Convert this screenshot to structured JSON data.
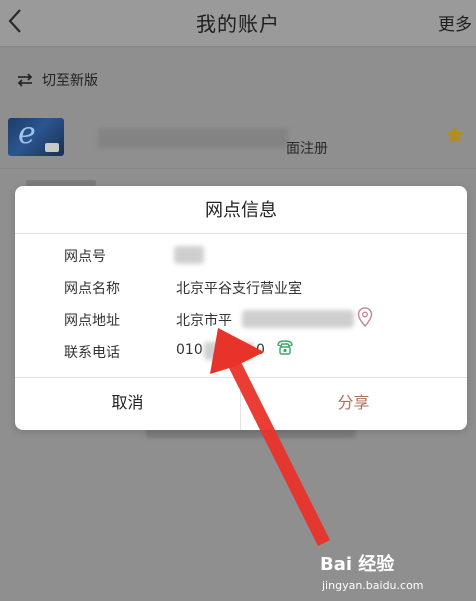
{
  "header": {
    "title": "我的账户",
    "more_label": "更多"
  },
  "switch_version": {
    "label": "切至新版"
  },
  "account": {
    "status_text": "面注册"
  },
  "dialog": {
    "title": "网点信息",
    "rows": [
      {
        "label": "网点号",
        "value": ""
      },
      {
        "label": "网点名称",
        "value": "北京平谷支行营业室"
      },
      {
        "label": "网点地址",
        "value": "北京市平"
      },
      {
        "label": "联系电话",
        "value": "010",
        "value_suffix": "0"
      }
    ],
    "cancel_label": "取消",
    "share_label": "分享"
  },
  "watermark": {
    "logo_text": "Bai 经验",
    "url_text": "jingyan.baidu.com"
  },
  "colors": {
    "share_text": "#b0705d",
    "location_icon": "#c88a9b",
    "phone_icon": "#3aa66a",
    "favorite_icon": "#b38d1e",
    "annotation_arrow": "#e8332a"
  },
  "icons": {
    "back": "chevron-left-icon",
    "switch": "switch-arrows-icon",
    "favorite": "star-icon",
    "location": "location-pin-icon",
    "phone": "telephone-icon"
  }
}
